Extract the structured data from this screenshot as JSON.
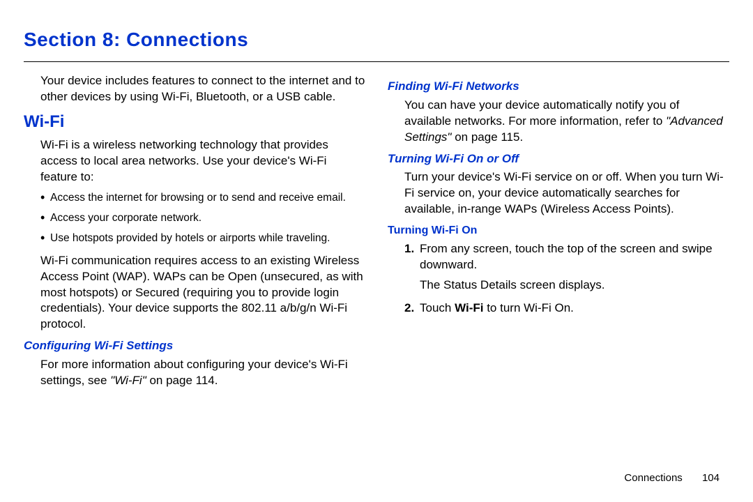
{
  "section_title": "Section 8: Connections",
  "left": {
    "intro": "Your device includes features to connect to the internet and to other devices by using Wi-Fi, Bluetooth, or a USB cable.",
    "h2": "Wi-Fi",
    "wifi_intro": "Wi-Fi is a wireless networking technology that provides access to local area networks. Use your device's Wi-Fi feature to:",
    "bullets": [
      "Access the internet for browsing or to send and receive email.",
      "Access your corporate network.",
      "Use hotspots provided by hotels or airports while traveling."
    ],
    "wap_para": "Wi-Fi communication requires access to an existing Wireless Access Point (WAP). WAPs can be Open (unsecured, as with most hotspots) or Secured (requiring you to provide login credentials). Your device supports the 802.11 a/b/g/n Wi-Fi protocol.",
    "h3_config": "Configuring Wi-Fi Settings",
    "config_para_a": "For more information about configuring your device's Wi-Fi settings, see ",
    "config_ref": "\"Wi-Fi\"",
    "config_para_b": " on page 114."
  },
  "right": {
    "h3_finding": "Finding Wi-Fi Networks",
    "finding_a": "You can have your device automatically notify you of available networks. For more information, refer to ",
    "finding_ref": "\"Advanced Settings\"",
    "finding_b": " on page 115.",
    "h3_toggle": "Turning Wi-Fi On or Off",
    "toggle_para": "Turn your device's Wi-Fi service on or off. When you turn Wi-Fi service on, your device automatically searches for available, in-range WAPs (Wireless Access Points).",
    "h4_on": "Turning Wi-Fi On",
    "steps": [
      {
        "num": "1.",
        "text": "From any screen, touch the top of the screen and swipe downward.",
        "sub": "The Status Details screen displays."
      },
      {
        "num": "2.",
        "text_a": "Touch ",
        "bold": "Wi-Fi",
        "text_b": " to turn Wi-Fi On."
      }
    ]
  },
  "footer": {
    "label": "Connections",
    "page": "104"
  }
}
